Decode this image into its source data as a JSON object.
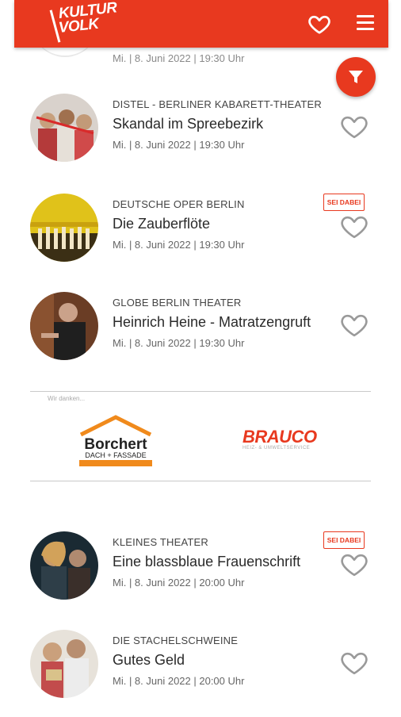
{
  "header": {
    "logo_line1": "KULTUR",
    "logo_line2": "VOLK",
    "brand_color": "#e8391f"
  },
  "partial_event": {
    "date": "Mi. | 8. Juni 2022 | 19:30 Uhr"
  },
  "events": [
    {
      "venue": "DISTEL - BERLINER KABARETT-THEATER",
      "title": "Skandal im Spreebezirk",
      "date": "Mi. | 8. Juni 2022 | 19:30 Uhr",
      "badge": ""
    },
    {
      "venue": "DEUTSCHE OPER BERLIN",
      "title": "Die Zauberflöte",
      "date": "Mi. | 8. Juni 2022 | 19:30 Uhr",
      "badge": "SEI DABEI"
    },
    {
      "venue": "GLOBE BERLIN THEATER",
      "title": "Heinrich Heine - Matratzengruft",
      "date": "Mi. | 8. Juni 2022 | 19:30 Uhr",
      "badge": ""
    },
    {
      "venue": "KLEINES THEATER",
      "title": "Eine blassblaue Frauenschrift",
      "date": "Mi. | 8. Juni 2022 | 20:00 Uhr",
      "badge": "SEI DABEI"
    },
    {
      "venue": "DIE STACHELSCHWEINE",
      "title": "Gutes Geld",
      "date": "Mi. | 8. Juni 2022 | 20:00 Uhr",
      "badge": ""
    }
  ],
  "sponsors": {
    "label": "Wir danken...",
    "borchert_name": "Borchert",
    "borchert_sub": "DACH + FASSADE",
    "brauco_name": "BRAUCO",
    "brauco_sub": "HEIZ- & UMWELTSERVICE"
  },
  "icons": {
    "header_heart": "heart-outline-icon",
    "menu": "hamburger-menu-icon",
    "filter": "funnel-filter-icon",
    "favorite": "heart-outline-icon"
  }
}
